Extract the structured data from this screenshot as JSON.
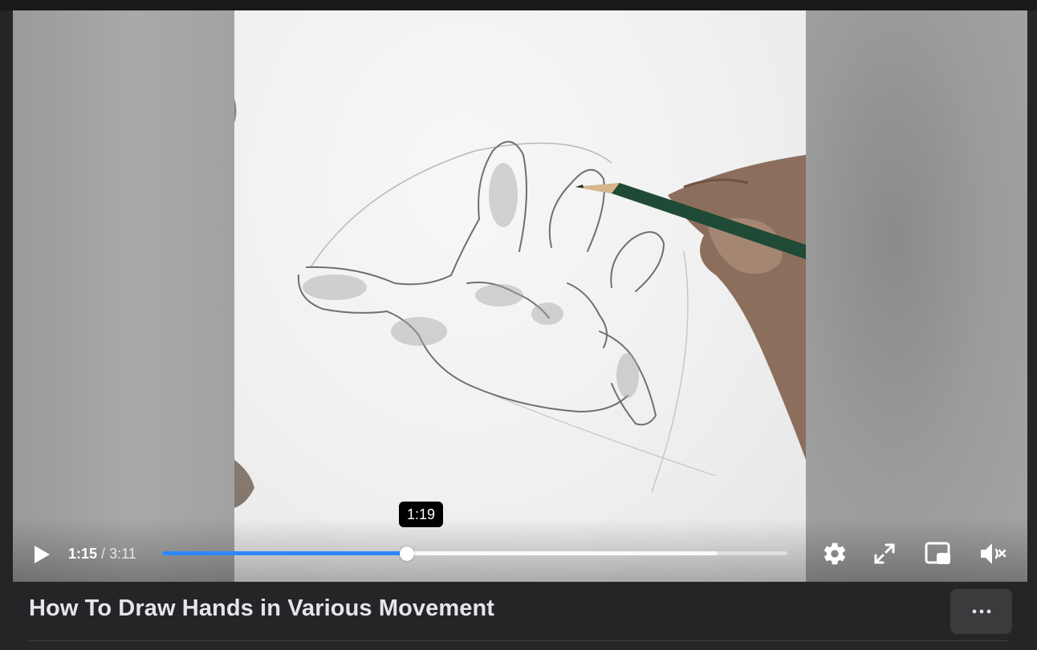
{
  "video": {
    "title": "How To Draw Hands in Various Movement",
    "current_time": "1:15",
    "time_separator": "/",
    "duration": "3:11",
    "hover_time": "1:19",
    "progress_fraction": 0.392,
    "buffered_fraction": 0.888
  },
  "controls": {
    "play": "play-icon",
    "settings": "gear-icon",
    "fullscreen": "fullscreen-icon",
    "pip": "picture-in-picture-icon",
    "mute": "muted-speaker-icon"
  },
  "more_options": "ellipsis-icon",
  "colors": {
    "progress_played": "#2d88ff",
    "background": "#242526",
    "title_text": "#e4e6eb",
    "more_button_bg": "#3a3b3c"
  }
}
